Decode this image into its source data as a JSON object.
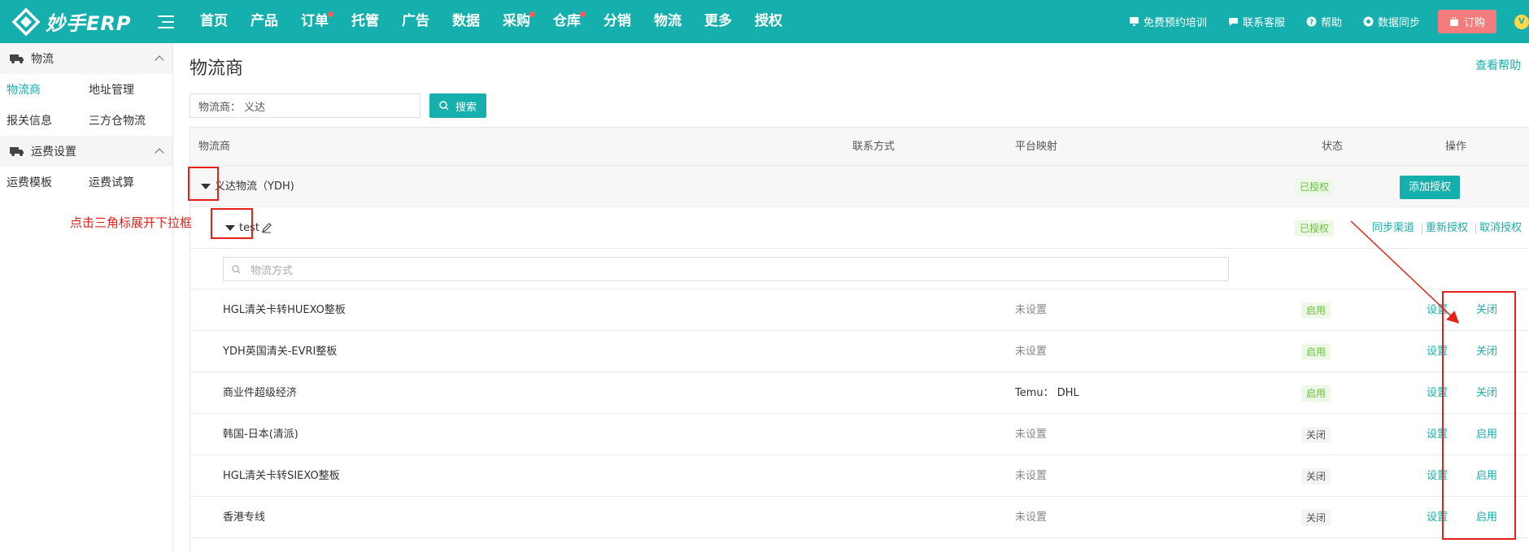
{
  "header": {
    "logo_text": "妙手ERP",
    "nav": [
      {
        "label": "首页",
        "dot": false
      },
      {
        "label": "产品",
        "dot": false
      },
      {
        "label": "订单",
        "dot": true
      },
      {
        "label": "托管",
        "dot": false
      },
      {
        "label": "广告",
        "dot": false
      },
      {
        "label": "数据",
        "dot": false
      },
      {
        "label": "采购",
        "dot": true
      },
      {
        "label": "仓库",
        "dot": true
      },
      {
        "label": "分销",
        "dot": false
      },
      {
        "label": "物流",
        "dot": false
      },
      {
        "label": "更多",
        "dot": false
      },
      {
        "label": "授权",
        "dot": false
      }
    ],
    "tools": {
      "training": "免费预约培训",
      "contact": "联系客服",
      "help": "帮助",
      "sync": "数据同步",
      "order": "订购"
    },
    "avatar_letter": "V"
  },
  "sidebar": {
    "group1": {
      "title": "物流",
      "items": [
        "物流商",
        "地址管理",
        "报关信息",
        "三方仓物流"
      ]
    },
    "group2": {
      "title": "运费设置",
      "items": [
        "运费模板",
        "运费试算"
      ]
    }
  },
  "main": {
    "title": "物流商",
    "help": "查看帮助",
    "search_value": "物流商： 义达",
    "search_button": "搜索",
    "columns": {
      "provider": "物流商",
      "contact": "联系方式",
      "mapping": "平台映射",
      "status": "状态",
      "actions": "操作"
    },
    "provider": {
      "name": "义达物流（YDH)",
      "status": "已授权",
      "add_auth": "添加授权"
    },
    "account": {
      "name": "test",
      "status": "已授权",
      "sync": "同步渠道",
      "reauth": "重新授权",
      "revoke": "取消授权"
    },
    "method_placeholder": "物流方式",
    "methods": [
      {
        "name": "HGL清关卡转HUEXO整板",
        "mapping": "未设置",
        "status": "启用",
        "enabled": true,
        "set": "设置",
        "toggle": "关闭"
      },
      {
        "name": "YDH英国清关-EVRI整板",
        "mapping": "未设置",
        "status": "启用",
        "enabled": true,
        "set": "设置",
        "toggle": "关闭"
      },
      {
        "name": "商业件超级经济",
        "mapping": "Temu： DHL",
        "status": "启用",
        "enabled": true,
        "set": "设置",
        "toggle": "关闭"
      },
      {
        "name": "韩国-日本(清派)",
        "mapping": "未设置",
        "status": "关闭",
        "enabled": false,
        "set": "设置",
        "toggle": "启用"
      },
      {
        "name": "HGL清关卡转SIEXO整板",
        "mapping": "未设置",
        "status": "关闭",
        "enabled": false,
        "set": "设置",
        "toggle": "启用"
      },
      {
        "name": "香港专线",
        "mapping": "未设置",
        "status": "关闭",
        "enabled": false,
        "set": "设置",
        "toggle": "启用"
      }
    ]
  },
  "annotation": {
    "text": "点击三角标展开下拉框",
    "color": "#e8201a"
  },
  "colors": {
    "brand": "#15b0ae",
    "order_button": "#f47c7c",
    "status_on": "#67c23a"
  }
}
